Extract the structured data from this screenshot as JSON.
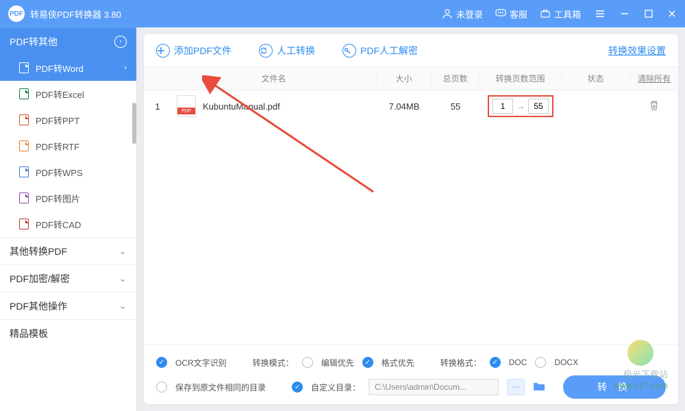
{
  "titlebar": {
    "app_name": "转易侠PDF转换器 3.80",
    "login": "未登录",
    "support": "客服",
    "toolbox": "工具箱"
  },
  "sidebar": {
    "header": "PDF转其他",
    "items": [
      {
        "label": "PDF转Word"
      },
      {
        "label": "PDF转Excel"
      },
      {
        "label": "PDF转PPT"
      },
      {
        "label": "PDF转RTF"
      },
      {
        "label": "PDF转WPS"
      },
      {
        "label": "PDF转图片"
      },
      {
        "label": "PDF转CAD"
      }
    ],
    "groups": [
      {
        "label": "其他转换PDF"
      },
      {
        "label": "PDF加密/解密"
      },
      {
        "label": "PDF其他操作"
      },
      {
        "label": "精品模板"
      }
    ]
  },
  "toolbar": {
    "add_pdf": "添加PDF文件",
    "manual_convert": "人工转换",
    "manual_decrypt": "PDF人工解密",
    "effect_setting": "转换效果设置"
  },
  "table": {
    "headers": {
      "filename": "文件名",
      "size": "大小",
      "pages": "总页数",
      "range": "转换页数范围",
      "status": "状态",
      "clear_all": "清除所有"
    },
    "rows": [
      {
        "idx": "1",
        "pdf_tag": "PDF",
        "name": "KubuntuManual.pdf",
        "size": "7.04MB",
        "pages": "55",
        "range_from": "1",
        "range_to": "55"
      }
    ]
  },
  "footer": {
    "ocr": "OCR文字识别",
    "mode_label": "转换模式：",
    "mode_edit": "编辑优先",
    "mode_format": "格式优先",
    "fmt_label": "转换格式：",
    "fmt_doc": "DOC",
    "fmt_docx": "DOCX",
    "save_same": "保存到原文件相同的目录",
    "save_custom": "自定义目录：",
    "path": "C:\\Users\\admin\\Docum...",
    "convert": "转 换"
  },
  "watermark": {
    "name": "极光下载站",
    "url": "www.xz7.com"
  }
}
